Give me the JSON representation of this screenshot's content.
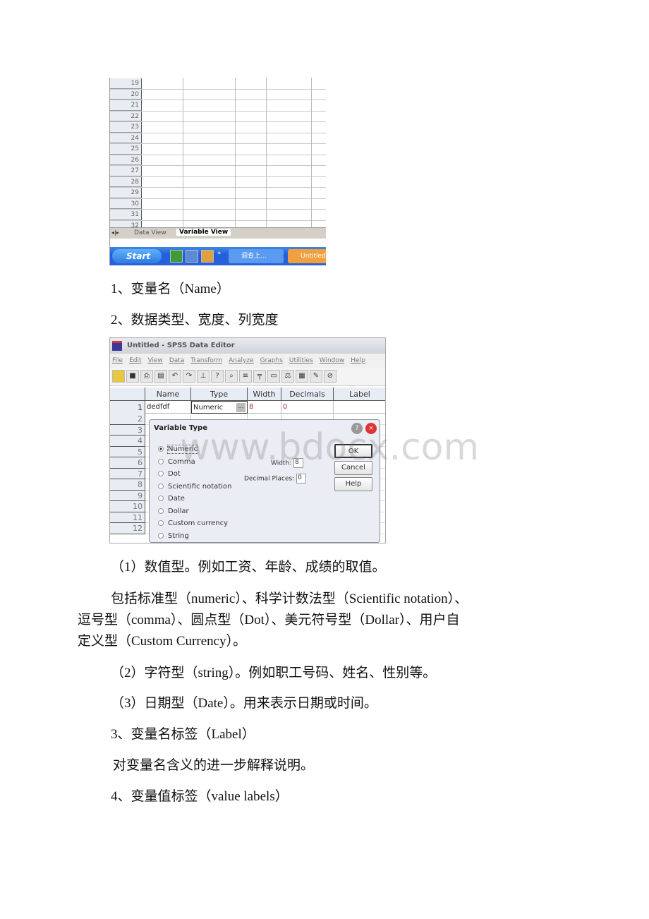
{
  "shot1": {
    "rows": [
      "19",
      "20",
      "21",
      "22",
      "23",
      "24",
      "25",
      "26",
      "27",
      "28",
      "29",
      "30",
      "31",
      "32"
    ],
    "tabs": {
      "data_view": "Data View",
      "variable_view": "Variable View"
    },
    "taskbar": {
      "start": "Start",
      "quicklaunch_more": "»",
      "task1": "调查上...",
      "task2": "Untitled"
    }
  },
  "headings": {
    "h1": "1、变量名（Name）",
    "h2": "2、数据类型、宽度、列宽度"
  },
  "shot2": {
    "title": "Untitled - SPSS Data Editor",
    "menu": [
      "File",
      "Edit",
      "View",
      "Data",
      "Transform",
      "Analyze",
      "Graphs",
      "Utilities",
      "Window",
      "Help"
    ],
    "columns": [
      "Name",
      "Type",
      "Width",
      "Decimals",
      "Label"
    ],
    "row1": {
      "num": "1",
      "name": "dedfdf",
      "type": "Numeric",
      "type_button": "...",
      "width": "8",
      "decimals": "0"
    },
    "rownums": [
      "2",
      "3",
      "4",
      "5",
      "6",
      "7",
      "8",
      "9",
      "10",
      "11",
      "12"
    ],
    "dialog": {
      "title": "Variable Type",
      "options": [
        "Numeric",
        "Comma",
        "Dot",
        "Scientific notation",
        "Date",
        "Dollar",
        "Custom currency",
        "String"
      ],
      "selected": "Numeric",
      "width_label": "Width:",
      "width_value": "8",
      "decimals_label": "Decimal Places:",
      "decimals_value": "0",
      "ok": "OK",
      "cancel": "Cancel",
      "help": "Help"
    }
  },
  "watermark": "www.bdocx.com",
  "body": {
    "p1": "（1）数值型。例如工资、年龄、成绩的取值。",
    "p2a": "包括标准型（numeric）、科学计数法型（Scientific notation）、",
    "p2b": "逗号型（comma）、圆点型（Dot）、美元符号型（Dollar）、用户自",
    "p2c": "定义型（Custom Currency）。",
    "p3": "（2）字符型（string）。例如职工号码、姓名、性别等。",
    "p4": "（3）日期型（Date）。用来表示日期或时间。",
    "h3": "3、变量名标签（Label）",
    "p5": "对变量名含义的进一步解释说明。",
    "h4": "4、变量值标签（value labels）"
  }
}
